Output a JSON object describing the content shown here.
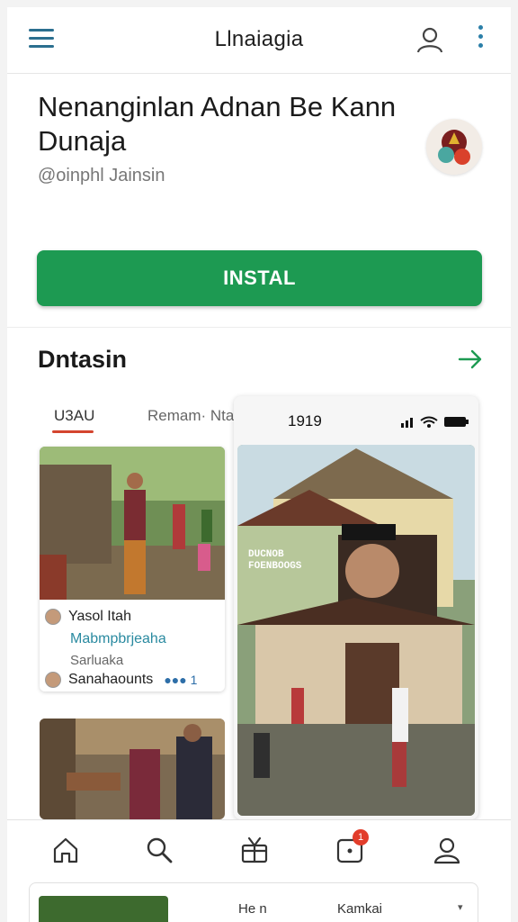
{
  "header": {
    "title": "Llnaiagia"
  },
  "app": {
    "name": "Nenanginlan Adnan Be Kann Dunaja",
    "author": "@oinphl Jainsin",
    "install_label": "INSTAL"
  },
  "section": {
    "title": "Dntasin",
    "tabs": [
      {
        "label": "U3AU",
        "active": true
      },
      {
        "label": "Remam· Ntam",
        "active": false
      }
    ]
  },
  "post_card": {
    "line1": "Yasol Itah",
    "line2": "Mabmpbrjeaha",
    "line3": "Sarluaka",
    "line4": "Sanahaounts",
    "reactions": "1"
  },
  "phone_preview": {
    "time": "1919",
    "overlay_text": "DUCNOB\nFOENBOOGS"
  },
  "bottom_nav": {
    "items": [
      {
        "icon": "home-icon"
      },
      {
        "icon": "search-icon"
      },
      {
        "icon": "gift-icon"
      },
      {
        "icon": "notifications-icon",
        "badge": "1"
      },
      {
        "icon": "profile-icon"
      }
    ]
  },
  "peek_card": {
    "label1": "He n",
    "label2": "Kamkai"
  },
  "colors": {
    "install": "#1d9a52",
    "accent_blue": "#2b7fa8",
    "tab_underline": "#d4452f",
    "badge": "#e23d2b"
  }
}
